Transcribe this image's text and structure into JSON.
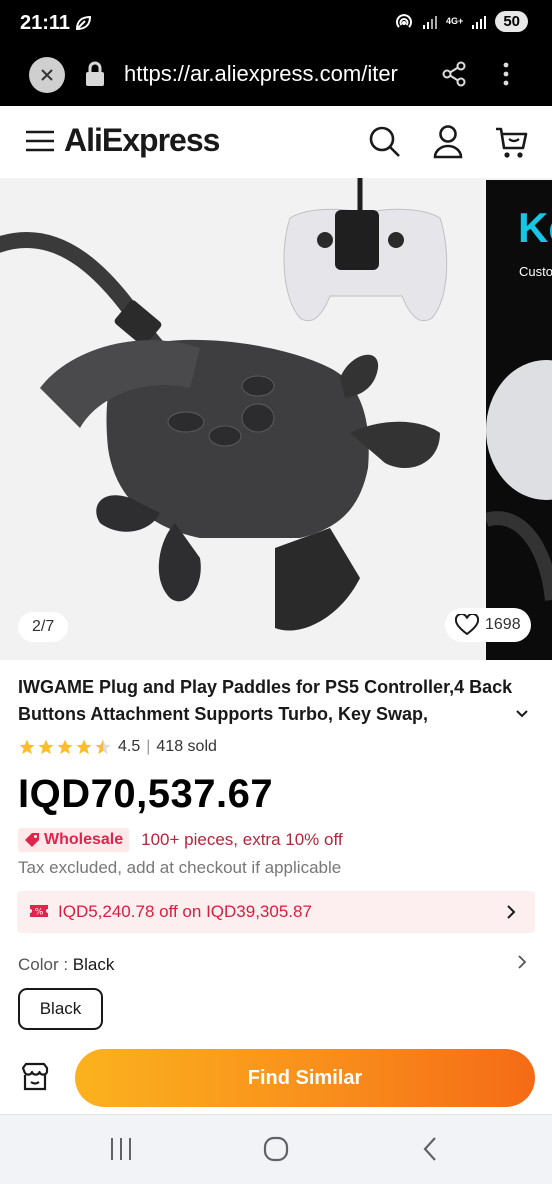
{
  "status_bar": {
    "time": "21:11",
    "network": "4G+",
    "battery": "50"
  },
  "browser": {
    "url": "https://ar.aliexpress.com/iter"
  },
  "header": {
    "logo": "AliExpress"
  },
  "gallery": {
    "counter": "2/7",
    "wishlist_count": "1698",
    "next_image_title": "Ke",
    "next_image_subtitle": "Custo"
  },
  "product": {
    "title": "IWGAME Plug and Play Paddles for PS5 Controller,4 Back Buttons Attachment Supports Turbo, Key Swap,",
    "rating": "4.5",
    "sold": "418 sold",
    "price": "IQD70,537.67",
    "wholesale_badge": "Wholesale",
    "wholesale_text": "100+ pieces, extra 10% off",
    "tax_note": "Tax excluded, add at checkout if applicable",
    "coupon_text": "IQD5,240.78 off on IQD39,305.87",
    "color_label": "Color : ",
    "color_value": "Black",
    "variants": [
      "Black"
    ]
  },
  "actions": {
    "find_similar": "Find Similar"
  },
  "colors": {
    "accent": "#fd384f",
    "coupon_text": "#d4213f",
    "button_start": "#fbb21e",
    "button_end": "#f56b16"
  }
}
